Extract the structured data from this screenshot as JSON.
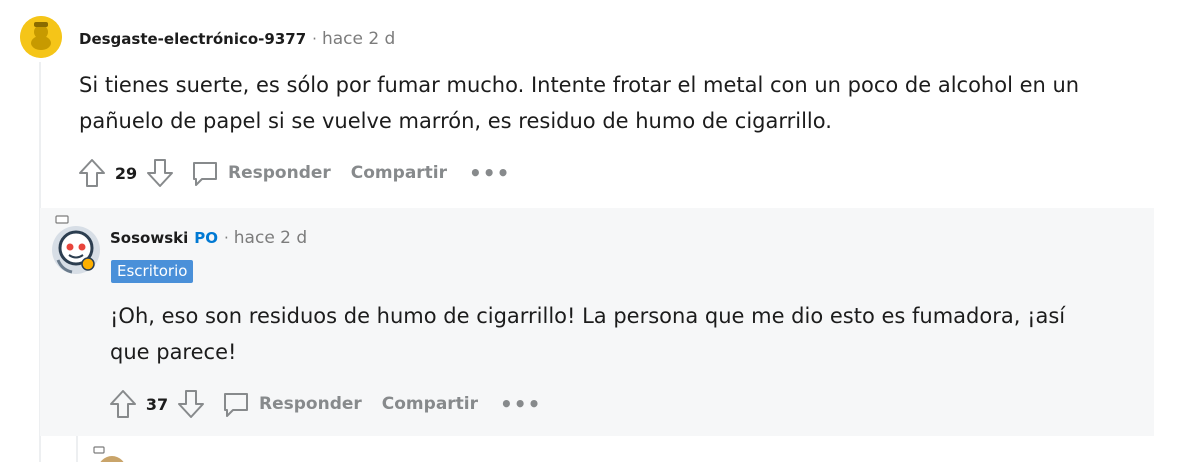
{
  "comments": [
    {
      "username": "Desgaste-electrónico-9377",
      "separator": "·",
      "time": "hace 2 d",
      "body_lines": [
        "Si tienes suerte, es sólo por fumar mucho. Intente frotar el metal con un poco de alcohol en un",
        "pañuelo de papel si se vuelve marrón, es residuo de humo de cigarrillo."
      ],
      "score": "29",
      "reply_label": "Responder",
      "share_label": "Compartir",
      "more_label": "•••"
    },
    {
      "username": "Sosowski",
      "op_tag": "PO",
      "separator": "·",
      "time": "hace 2 d",
      "flair": "Escritorio",
      "body_lines": [
        "¡Oh, eso son residuos de humo de cigarrillo! La persona que me dio esto es fumadora, ¡así",
        "que parece!"
      ],
      "score": "37",
      "reply_label": "Responder",
      "share_label": "Compartir",
      "more_label": "•••"
    }
  ],
  "colors": {
    "background": "#ffffff",
    "reply_background": "#f6f7f8",
    "flair_background": "#4a90d9",
    "op_tag": "#0079d3",
    "muted": "#878a8c",
    "avatar_yellow": "#f5c518"
  },
  "icons": {
    "upvote": "upvote-arrow-icon",
    "downvote": "downvote-arrow-icon",
    "reply": "comment-bubble-icon",
    "more": "more-horizontal-icon",
    "avatar_1": "snoo-avatar-yellow",
    "avatar_2": "snoo-avatar-astronaut"
  }
}
